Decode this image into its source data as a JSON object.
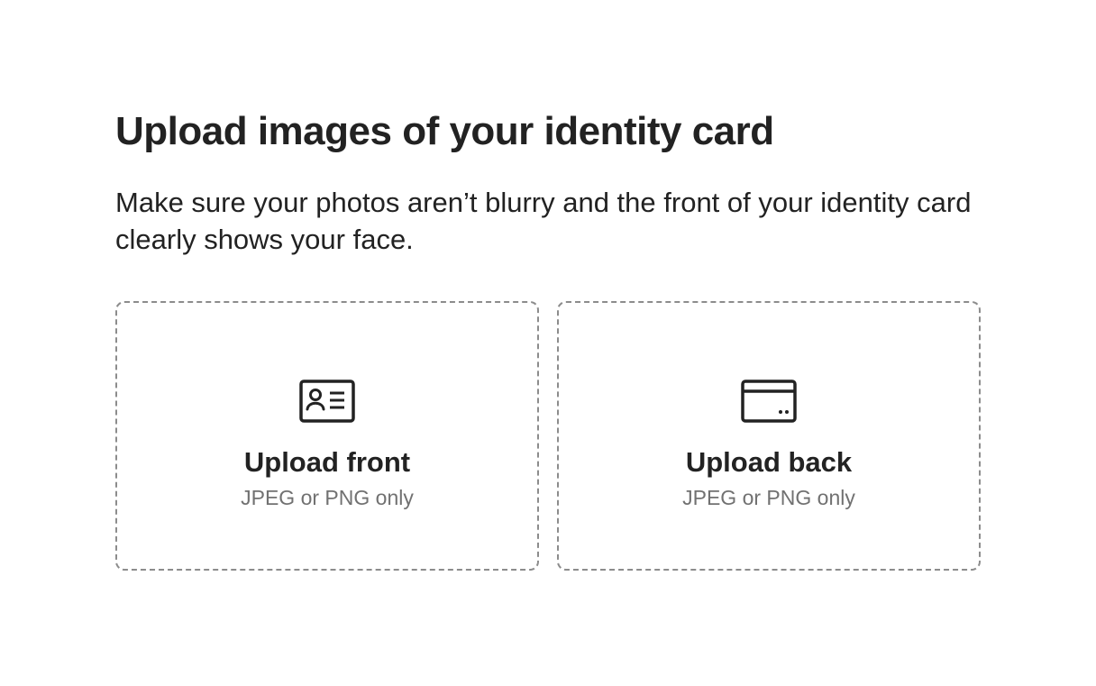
{
  "page": {
    "title": "Upload images of your identity card",
    "subtitle": "Make sure your photos aren’t blurry and the front of your identity card clearly shows your face."
  },
  "uploads": [
    {
      "label": "Upload front",
      "hint": "JPEG or PNG only",
      "icon": "id-card-front-icon"
    },
    {
      "label": "Upload back",
      "hint": "JPEG or PNG only",
      "icon": "id-card-back-icon"
    }
  ],
  "colors": {
    "text_primary": "#222222",
    "text_secondary": "#717171",
    "dashed_border": "#8c8c8c",
    "background": "#ffffff"
  }
}
